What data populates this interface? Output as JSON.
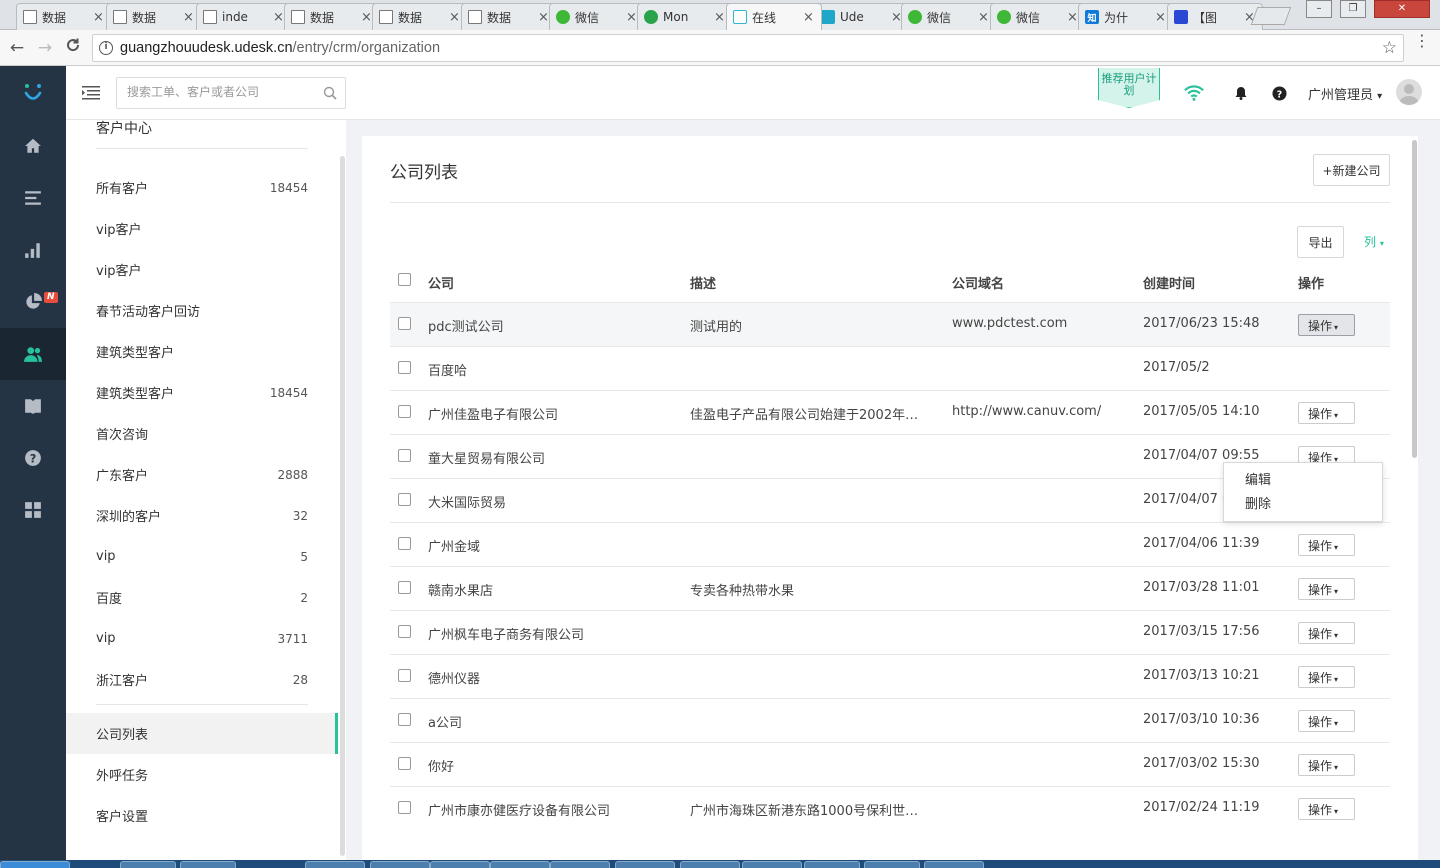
{
  "browser": {
    "tabs": [
      {
        "title": "数据",
        "icon": "doc"
      },
      {
        "title": "数据",
        "icon": "doc"
      },
      {
        "title": "inde",
        "icon": "doc"
      },
      {
        "title": "数据",
        "icon": "doc"
      },
      {
        "title": "数据",
        "icon": "doc"
      },
      {
        "title": "数据",
        "icon": "doc"
      },
      {
        "title": "微信",
        "icon": "wechat"
      },
      {
        "title": "Mon",
        "icon": "mon"
      },
      {
        "title": "在线",
        "icon": "udesk",
        "active": true
      },
      {
        "title": "Ude",
        "icon": "udesk2"
      },
      {
        "title": "微信",
        "icon": "wechat"
      },
      {
        "title": "微信",
        "icon": "wechat"
      },
      {
        "title": "为什",
        "icon": "zhihu",
        "glyph": "知"
      },
      {
        "title": "【图",
        "icon": "baidu"
      }
    ],
    "close_glyph": "×",
    "url_host": "guangzhouudesk.udesk.cn",
    "url_path": "/entry/crm/organization",
    "back_glyph": "←",
    "forward_glyph": "→",
    "reload_glyph": "C",
    "star_glyph": "☆",
    "menu_glyph": "⋮",
    "info_glyph": "i",
    "window_controls": [
      "–",
      "❐",
      "✕"
    ]
  },
  "header": {
    "search_placeholder": "搜索工单、客户或者公司",
    "recommend_label": "推荐用户计划",
    "user_name": "广州管理员",
    "user_caret": "▾"
  },
  "nav": {
    "items": [
      "home",
      "tickets",
      "reports",
      "analytics",
      "customers",
      "knowledge",
      "help",
      "apps"
    ],
    "active": "customers",
    "badge": "N"
  },
  "sidebar": {
    "title": "客户中心",
    "filters": [
      {
        "label": "所有客户",
        "count": "18454"
      },
      {
        "label": "vip客户",
        "count": ""
      },
      {
        "label": "vip客户",
        "count": ""
      },
      {
        "label": "春节活动客户回访",
        "count": ""
      },
      {
        "label": "建筑类型客户",
        "count": ""
      },
      {
        "label": "建筑类型客户",
        "count": "18454"
      },
      {
        "label": "首次咨询",
        "count": ""
      },
      {
        "label": "广东客户",
        "count": "2888"
      },
      {
        "label": "深圳的客户",
        "count": "32"
      },
      {
        "label": "vip",
        "count": "5"
      },
      {
        "label": "百度",
        "count": "2"
      },
      {
        "label": "vip",
        "count": "3711"
      },
      {
        "label": "浙江客户",
        "count": "28"
      }
    ],
    "links": [
      {
        "label": "公司列表",
        "active": true
      },
      {
        "label": "外呼任务"
      },
      {
        "label": "客户设置"
      }
    ]
  },
  "main": {
    "title": "公司列表",
    "new_button": "+新建公司",
    "export_button": "导出",
    "columns_toggle": "列",
    "caret": "▾",
    "headers": {
      "company": "公司",
      "description": "描述",
      "domain": "公司域名",
      "created": "创建时间",
      "action": "操作"
    },
    "action_label": "操作",
    "dropdown": [
      "编辑",
      "删除"
    ],
    "rows": [
      {
        "company": "pdc测试公司",
        "description": "测试用的",
        "domain": "www.pdctest.com",
        "created": "2017/06/23 15:48"
      },
      {
        "company": "百度哈",
        "description": "",
        "domain": "",
        "created": "2017/05/2"
      },
      {
        "company": "广州佳盈电子有限公司",
        "description": "佳盈电子产品有限公司始建于2002年，...",
        "domain": "http://www.canuv.com/",
        "created": "2017/05/05 14:10"
      },
      {
        "company": "童大星贸易有限公司",
        "description": "",
        "domain": "",
        "created": "2017/04/07 09:55"
      },
      {
        "company": "大米国际贸易",
        "description": "",
        "domain": "",
        "created": "2017/04/07 09:50"
      },
      {
        "company": "广州金域",
        "description": "",
        "domain": "",
        "created": "2017/04/06 11:39"
      },
      {
        "company": "赣南水果店",
        "description": "专卖各种热带水果",
        "domain": "",
        "created": "2017/03/28 11:01"
      },
      {
        "company": "广州枫车电子商务有限公司",
        "description": "",
        "domain": "",
        "created": "2017/03/15 17:56"
      },
      {
        "company": "德州仪器",
        "description": "",
        "domain": "",
        "created": "2017/03/13 10:21"
      },
      {
        "company": "a公司",
        "description": "",
        "domain": "",
        "created": "2017/03/10 10:36"
      },
      {
        "company": "你好",
        "description": "",
        "domain": "",
        "created": "2017/03/02 15:30"
      },
      {
        "company": "广州市康亦健医疗设备有限公司",
        "description": "广州市海珠区新港东路1000号保利世界...",
        "domain": "",
        "created": "2017/02/24 11:19"
      }
    ]
  },
  "colors": {
    "accent": "#27c19b",
    "nav_bg": "#253444",
    "nav_active_bg": "#1a2632",
    "badge": "#e74c3c"
  }
}
